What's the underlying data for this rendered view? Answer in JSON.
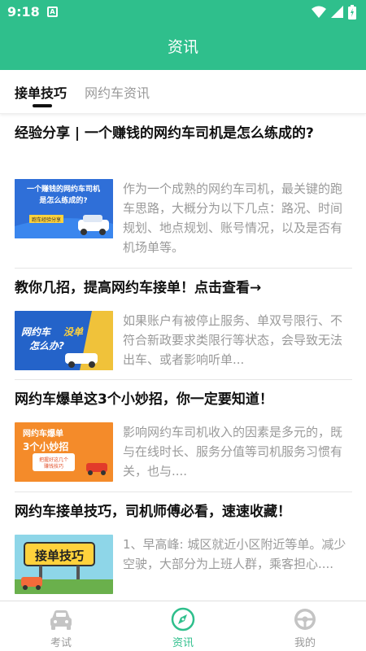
{
  "status_bar": {
    "time": "9:18",
    "notification_icon": "a-letter-icon",
    "icons": [
      "wifi-icon",
      "signal-icon",
      "battery-icon"
    ]
  },
  "app_bar": {
    "title": "资讯"
  },
  "tabs": [
    {
      "label": "接单技巧",
      "active": true
    },
    {
      "label": "网约车资讯",
      "active": false
    }
  ],
  "articles": [
    {
      "title": "经验分享 | 一个赚钱的网约车司机是怎么练成的?",
      "summary": "作为一个成熟的网约车司机，最关键的跑车思路，大概分为以下几点：路况、时间规划、地点规划、账号情况，以及是否有机场单等。",
      "thumb": {
        "line1": "一个赚钱的网约车司机",
        "line2": "是怎么练成的?",
        "tag": "跑车经验分享"
      }
    },
    {
      "title": "教你几招，提高网约车接单！点击查看→",
      "summary": "如果账户有被停止服务、单双号限行、不符合新政要求类限行等状态，会导致无法出车、或者影响听单...",
      "thumb": {
        "line1": "网约车",
        "line1b": "没单",
        "line2": "怎么办?"
      }
    },
    {
      "title": "网约车爆单这3个小妙招，你一定要知道！",
      "summary": "影响网约车司机收入的因素是多元的，既与在线时长、服务分值等司机服务习惯有关，也与....",
      "thumb": {
        "line1": "网约车爆单",
        "line2": "3个小妙招",
        "tag1": "把握好这几个",
        "tag2": "赚钱技巧"
      }
    },
    {
      "title": "网约车接单技巧，司机师傅必看，速速收藏！",
      "summary": "1、早高峰: 城区就近小区附近等单。减少空驶，大部分为上班人群，乘客担心....",
      "thumb": {
        "line1": "接单技巧"
      }
    }
  ],
  "bottom_nav": [
    {
      "label": "考试",
      "icon": "car-icon",
      "active": false
    },
    {
      "label": "资讯",
      "icon": "compass-icon",
      "active": true
    },
    {
      "label": "我的",
      "icon": "steering-wheel-icon",
      "active": false
    }
  ],
  "colors": {
    "primary": "#2fbf8c",
    "title_text": "#111111",
    "secondary_text": "#9a9a9a"
  }
}
